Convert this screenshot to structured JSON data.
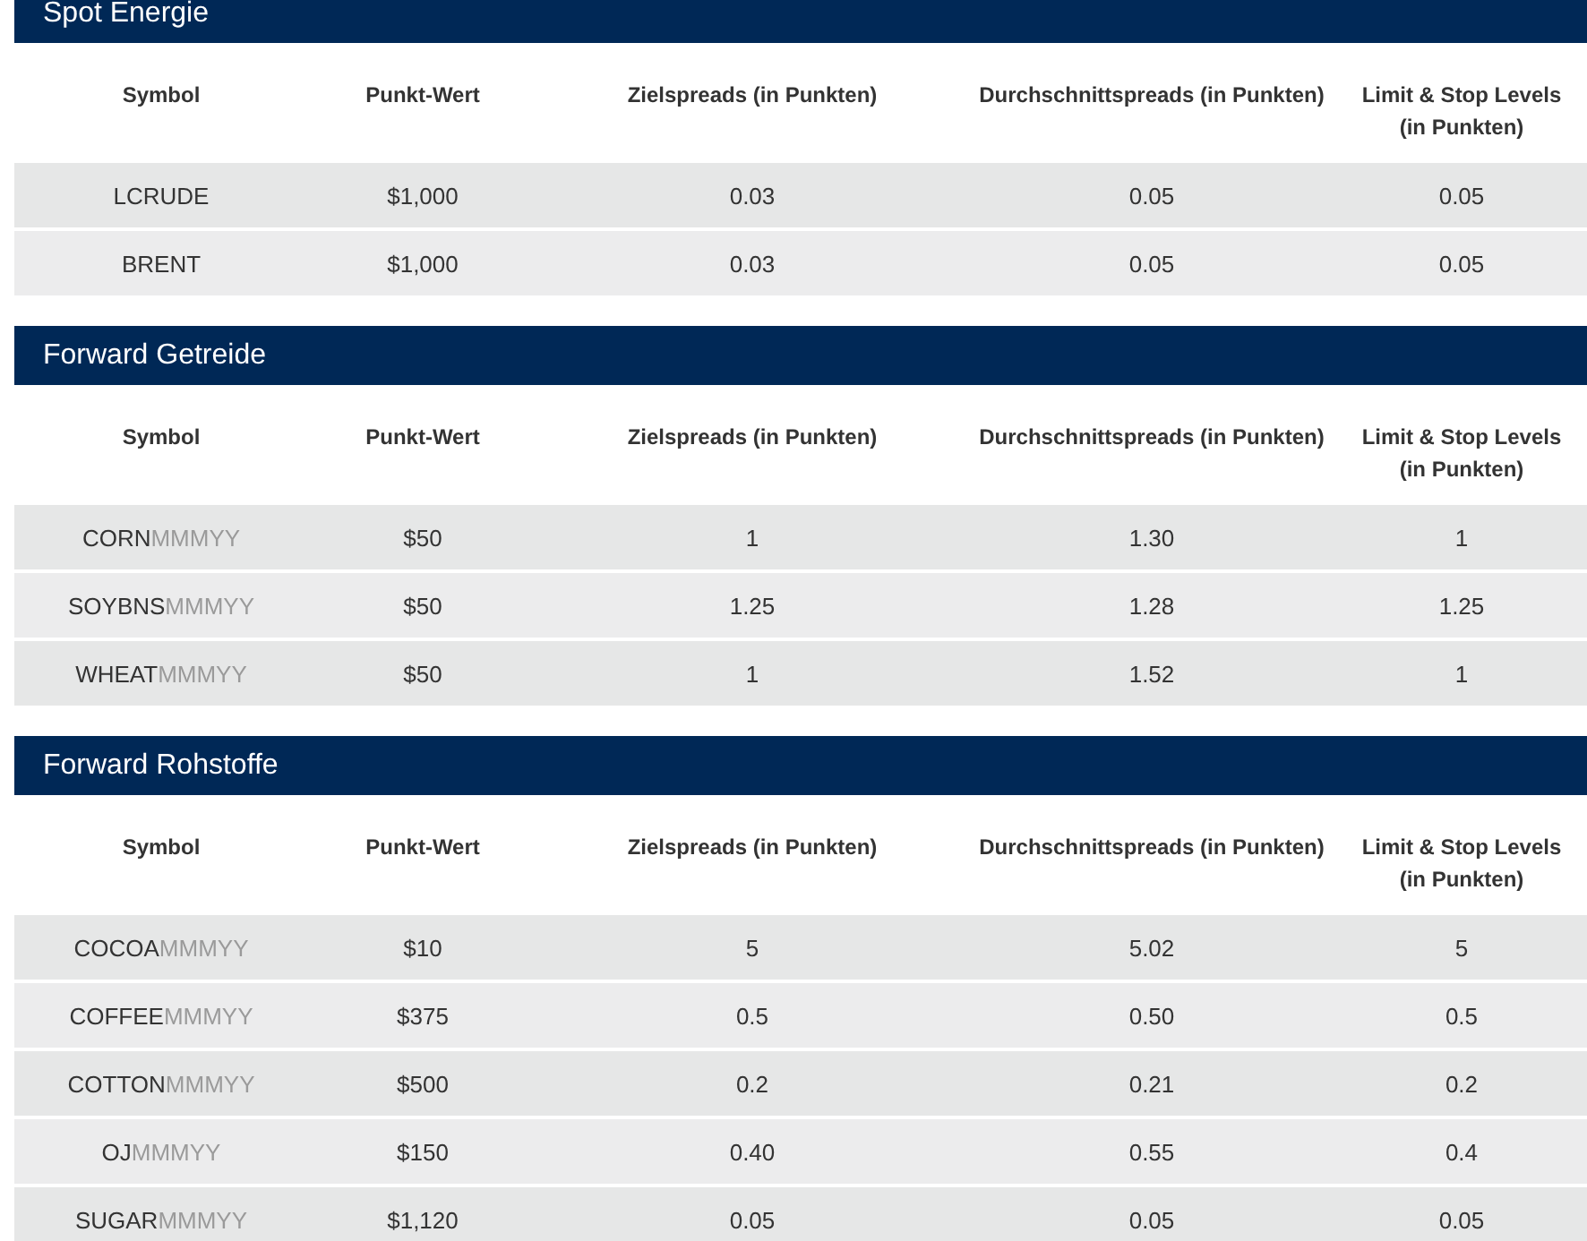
{
  "sections": [
    {
      "title": "Spot Energie",
      "columns": [
        "Symbol",
        "Punkt-Wert",
        "Zielspreads (in Punkten)",
        "Durchschnittspreads (in Punkten)",
        "Limit & Stop Levels (in Punkten)"
      ],
      "rows": [
        {
          "symbol": "LCRUDE",
          "point_value": "$1,000",
          "target_spread": "0.03",
          "average_spread": "0.05",
          "limit_stop": "0.05"
        },
        {
          "symbol": "BRENT",
          "point_value": "$1,000",
          "target_spread": "0.03",
          "average_spread": "0.05",
          "limit_stop": "0.05"
        }
      ]
    },
    {
      "title": "Forward Getreide",
      "columns": [
        "Symbol",
        "Punkt-Wert",
        "Zielspreads (in Punkten)",
        "Durchschnittspreads (in Punkten)",
        "Limit & Stop Levels (in Punkten)"
      ],
      "rows": [
        {
          "symbol": "CORN",
          "suffix": "MMMYY",
          "point_value": "$50",
          "target_spread": "1",
          "average_spread": "1.30",
          "limit_stop": "1"
        },
        {
          "symbol": "SOYBNS",
          "suffix": "MMMYY",
          "point_value": "$50",
          "target_spread": "1.25",
          "average_spread": "1.28",
          "limit_stop": "1.25"
        },
        {
          "symbol": "WHEAT",
          "suffix": "MMMYY",
          "point_value": "$50",
          "target_spread": "1",
          "average_spread": "1.52",
          "limit_stop": "1"
        }
      ]
    },
    {
      "title": "Forward Rohstoffe",
      "columns": [
        "Symbol",
        "Punkt-Wert",
        "Zielspreads (in Punkten)",
        "Durchschnittspreads (in Punkten)",
        "Limit & Stop Levels (in Punkten)"
      ],
      "rows": [
        {
          "symbol": "COCOA",
          "suffix": "MMMYY",
          "point_value": "$10",
          "target_spread": "5",
          "average_spread": "5.02",
          "limit_stop": "5"
        },
        {
          "symbol": "COFFEE",
          "suffix": "MMMYY",
          "point_value": "$375",
          "target_spread": "0.5",
          "average_spread": "0.50",
          "limit_stop": "0.5"
        },
        {
          "symbol": "COTTON",
          "suffix": "MMMYY",
          "point_value": "$500",
          "target_spread": "0.2",
          "average_spread": "0.21",
          "limit_stop": "0.2"
        },
        {
          "symbol": "OJ",
          "suffix": "MMMYY",
          "point_value": "$150",
          "target_spread": "0.40",
          "average_spread": "0.55",
          "limit_stop": "0.4"
        },
        {
          "symbol": "SUGAR",
          "suffix": "MMMYY",
          "point_value": "$1,120",
          "target_spread": "0.05",
          "average_spread": "0.05",
          "limit_stop": "0.05"
        }
      ]
    }
  ]
}
